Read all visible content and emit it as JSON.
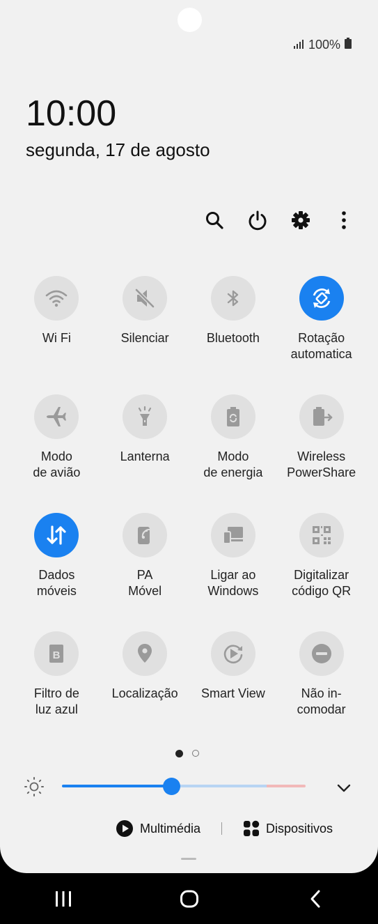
{
  "status_bar": {
    "battery_text": "100%",
    "signal_icon": "signal-icon",
    "battery_icon": "battery-icon"
  },
  "clock": {
    "time": "10:00",
    "date": "segunda, 17 de agosto"
  },
  "toolbar": {
    "items": [
      {
        "name": "search-icon"
      },
      {
        "name": "power-icon"
      },
      {
        "name": "settings-icon"
      },
      {
        "name": "more-options-icon"
      }
    ]
  },
  "tiles": [
    {
      "label": "Wi Fi",
      "icon": "wifi-icon",
      "active": false
    },
    {
      "label": "Silenciar",
      "icon": "mute-icon",
      "active": false
    },
    {
      "label": "Bluetooth",
      "icon": "bluetooth-icon",
      "active": false
    },
    {
      "label": "Rotação\nautomatica",
      "icon": "auto-rotate-icon",
      "active": true
    },
    {
      "label": "Modo\nde avião",
      "icon": "airplane-icon",
      "active": false
    },
    {
      "label": "Lanterna",
      "icon": "flashlight-icon",
      "active": false
    },
    {
      "label": "Modo\nde energia",
      "icon": "power-mode-icon",
      "active": false
    },
    {
      "label": "Wireless\nPowerShare",
      "icon": "wireless-powershare-icon",
      "active": false
    },
    {
      "label": "Dados\nmóveis",
      "icon": "mobile-data-icon",
      "active": true
    },
    {
      "label": "PA\nMóvel",
      "icon": "hotspot-icon",
      "active": false
    },
    {
      "label": "Ligar ao\nWindows",
      "icon": "link-to-windows-icon",
      "active": false
    },
    {
      "label": "Digitalizar\ncódigo QR",
      "icon": "qr-code-icon",
      "active": false
    },
    {
      "label": "Filtro de\nluz azul",
      "icon": "blue-light-filter-icon",
      "active": false
    },
    {
      "label": "Localização",
      "icon": "location-icon",
      "active": false
    },
    {
      "label": "Smart View",
      "icon": "smart-view-icon",
      "active": false
    },
    {
      "label": "Não in-\ncomodar",
      "icon": "do-not-disturb-icon",
      "active": false
    }
  ],
  "pagination": {
    "current": 1,
    "total": 2
  },
  "brightness": {
    "level": 0.45
  },
  "media": {
    "multimedia_label": "Multimédia",
    "devices_label": "Dispositivos"
  },
  "colors": {
    "accent": "#1a81f0",
    "panel_bg": "#f1f1f1",
    "tile_bg": "#e0e0e0"
  }
}
